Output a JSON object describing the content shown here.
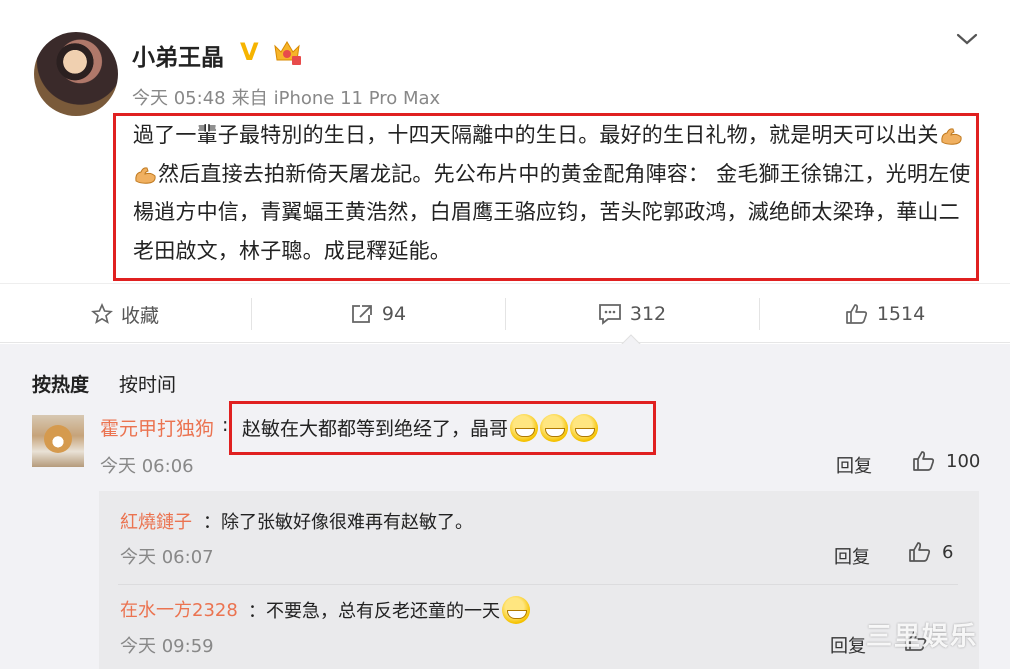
{
  "post": {
    "username": "小弟王晶",
    "verified_badge": "V",
    "time": "今天 05:48",
    "source_prefix": "来自",
    "source": "iPhone 11 Pro Max",
    "text_part1": "過了一輩子最特別的生日，十四天隔離中的生日。最好的生日礼物，就是明天可以出关",
    "text_part2": "然后直接去拍新倚天屠龙記。先公布片中的黄金配角陣容： 金毛獅王徐锦江，光明左使楊逍方中信，青翼蝠王黄浩然，白眉鹰王骆应钧，苦头陀郭政鸿，滅绝師太梁琤，華山二老田啟文，林子聰。成昆釋延能。"
  },
  "actions": {
    "favorite_label": "收藏",
    "repost_count": "94",
    "comment_count": "312",
    "like_count": "1514"
  },
  "comments": {
    "sort_hot": "按热度",
    "sort_time": "按时间",
    "main": {
      "name": "霍元甲打独狗",
      "colon": ":",
      "text": "赵敏在大都都等到绝经了，晶哥",
      "time": "今天 06:06",
      "reply_label": "回复",
      "likes": "100"
    },
    "replies": [
      {
        "name": "紅燒鏈子",
        "text": "除了张敏好像很难再有赵敏了。",
        "time": "今天 06:07",
        "reply_label": "回复",
        "likes": "6"
      },
      {
        "name": "在水一方2328",
        "text": "不要急，总有反老还童的一天",
        "time": "今天 09:59",
        "reply_label": "回复",
        "likes": ""
      }
    ]
  },
  "watermark": "三里娱乐",
  "colors": {
    "accent_red": "#e02020",
    "name_orange": "#eb7350",
    "badge_gold": "#f6b400"
  }
}
